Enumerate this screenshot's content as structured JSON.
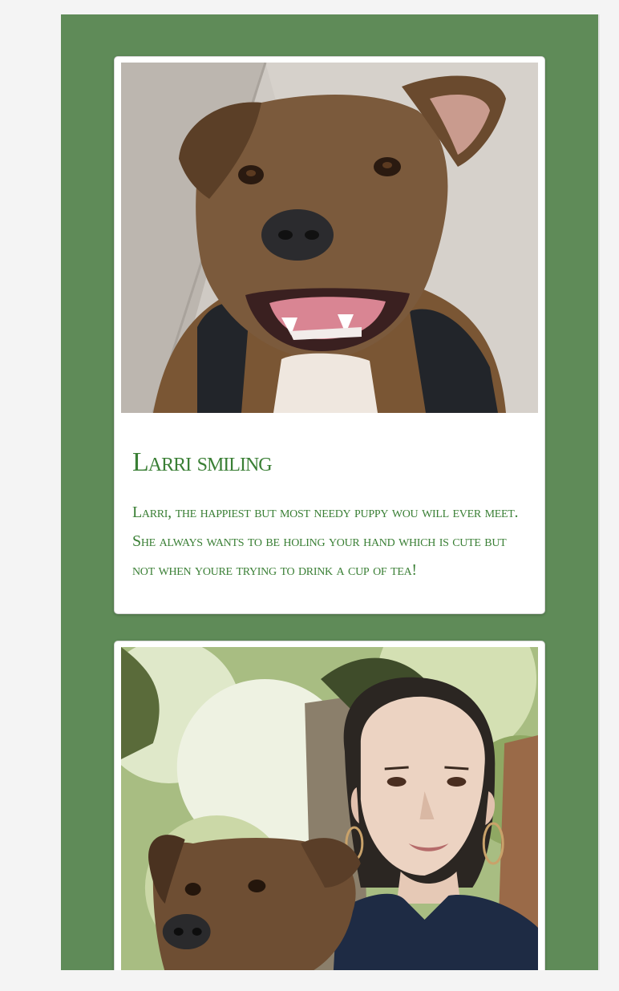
{
  "cards": [
    {
      "title": "Larri smiling",
      "description": "Larri, the happiest but most needy puppy wou will ever meet. She always wants to be holing your hand which is cute but not when youre trying to drink a cup of tea!",
      "image_icon": "dog-photo"
    },
    {
      "image_icon": "woman-and-dog-photo"
    }
  ],
  "colors": {
    "page_background": "#5f8b58",
    "card_background": "#ffffff",
    "text": "#3a7f35"
  }
}
